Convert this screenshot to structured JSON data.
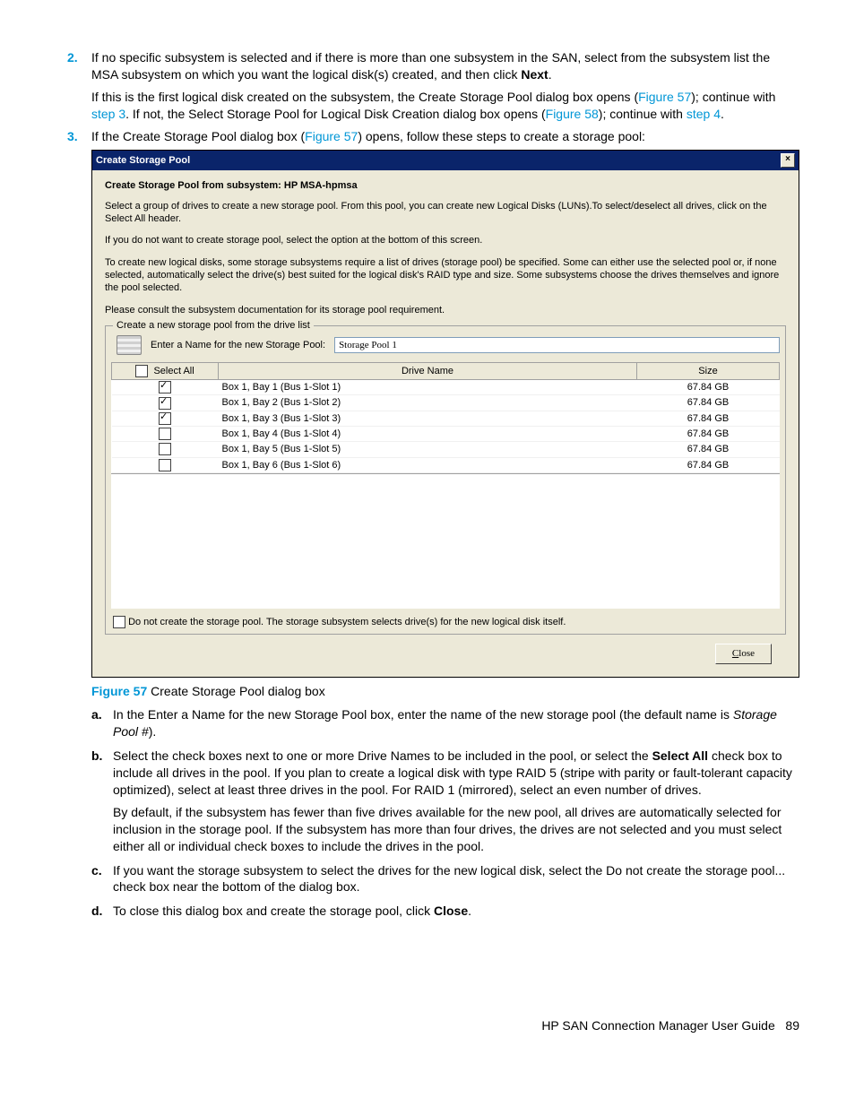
{
  "steps": {
    "s2": {
      "num": "2.",
      "text_pre": "If no specific subsystem is selected and if there is more than one subsystem in the SAN, select from the subsystem list the MSA subsystem on which you want the logical disk(s) created, and then click ",
      "text_bold": "Next",
      "text_post": ".",
      "p2_a": "If this is the first logical disk created on the subsystem, the Create Storage Pool dialog box opens (",
      "p2_link1": "Figure 57",
      "p2_b": "); continue with ",
      "p2_link2": "step 3",
      "p2_c": ". If not, the Select Storage Pool for Logical Disk Creation dialog box opens (",
      "p2_link3": "Figure 58",
      "p2_d": "); continue with ",
      "p2_link4": "step 4",
      "p2_e": "."
    },
    "s3": {
      "num": "3.",
      "text_a": "If the Create Storage Pool dialog box (",
      "text_link": "Figure 57",
      "text_b": ") opens, follow these steps to create a storage pool:"
    }
  },
  "dialog": {
    "title": "Create Storage Pool",
    "heading": "Create Storage Pool from subsystem: HP MSA-hpmsa",
    "p1": "Select a group of drives to create a new storage pool. From this pool, you can create new Logical Disks (LUNs).To select/deselect all drives, click on the Select All header.",
    "p2": "If you do not want to create storage pool, select the option at the bottom of this screen.",
    "p3": "To create new logical disks, some storage subsystems require a list of drives (storage pool) be specified. Some can either use the selected pool or, if none selected, automatically select the drive(s) best suited for the logical disk's RAID type and size. Some subsystems choose the drives themselves and ignore the pool selected.",
    "p4": "Please consult the subsystem documentation for its storage pool requirement.",
    "group_legend": "Create a new storage pool from the drive list",
    "name_label": "Enter a Name for the new Storage Pool:",
    "name_value": "Storage Pool 1",
    "headers": {
      "select": "Select All",
      "name": "Drive Name",
      "size": "Size"
    },
    "rows": [
      {
        "checked": true,
        "name": "Box 1, Bay 1 (Bus 1-Slot 1)",
        "size": "67.84 GB"
      },
      {
        "checked": true,
        "name": "Box 1, Bay 2 (Bus 1-Slot 2)",
        "size": "67.84 GB"
      },
      {
        "checked": true,
        "name": "Box 1, Bay 3 (Bus 1-Slot 3)",
        "size": "67.84 GB"
      },
      {
        "checked": false,
        "name": "Box 1, Bay 4 (Bus 1-Slot 4)",
        "size": "67.84 GB"
      },
      {
        "checked": false,
        "name": "Box 1, Bay 5 (Bus 1-Slot 5)",
        "size": "67.84 GB"
      },
      {
        "checked": false,
        "name": "Box 1, Bay 6 (Bus 1-Slot 6)",
        "size": "67.84 GB"
      }
    ],
    "do_not": "Do not create the storage pool. The storage subsystem selects drive(s) for the new logical disk itself.",
    "close_u": "C",
    "close_rest": "lose"
  },
  "figure": {
    "label": "Figure 57",
    "caption": " Create Storage Pool dialog box"
  },
  "letters": {
    "a": {
      "let": "a.",
      "t1": "In the Enter a Name for the new Storage Pool box, enter the name of the new storage pool (the default name is ",
      "italic": "Storage Pool #",
      "t2": ")."
    },
    "b": {
      "let": "b.",
      "t1": "Select the check boxes next to one or more Drive Names to be included in the pool, or select the ",
      "bold": "Select All",
      "t2": " check box to include all drives in the pool. If you plan to create a logical disk with type RAID 5 (stripe with parity or fault-tolerant capacity optimized), select at least three drives in the pool. For RAID 1 (mirrored), select an even number of drives.",
      "p2": "By default, if the subsystem has fewer than five drives available for the new pool, all drives are automatically selected for inclusion in the storage pool. If the subsystem has more than four drives, the drives are not selected and you must select either all or individual check boxes to include the drives in the pool."
    },
    "c": {
      "let": "c.",
      "t1": "If you want the storage subsystem to select the drives for the new logical disk, select the Do not create the storage pool... check box near the bottom of the dialog box."
    },
    "d": {
      "let": "d.",
      "t1": "To close this dialog box and create the storage pool, click ",
      "bold": "Close",
      "t2": "."
    }
  },
  "footer": {
    "title": "HP SAN Connection Manager User Guide",
    "page": "89"
  }
}
